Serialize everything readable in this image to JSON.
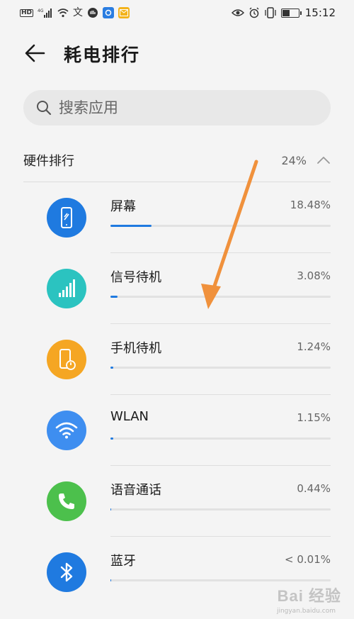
{
  "status_bar": {
    "left_icons": [
      "hd-icon",
      "4g-signal-icon",
      "wifi-icon",
      "translate-icon",
      "hand-icon",
      "app-blue-icon",
      "mail-yellow-icon"
    ],
    "right_icons": [
      "eye-icon",
      "alarm-icon",
      "vibrate-icon",
      "battery-icon"
    ],
    "hd_label": "HD",
    "net_label": "4G",
    "battery_level": 0.45,
    "time": "15:12"
  },
  "header": {
    "title": "耗电排行"
  },
  "search": {
    "placeholder": "搜索应用"
  },
  "section": {
    "title": "硬件排行",
    "percent": "24%"
  },
  "rows": [
    {
      "name": "屏幕",
      "percent": "18.48%",
      "level": 0.185,
      "icon": "phone-screen-icon",
      "color": "#1f7ae0"
    },
    {
      "name": "信号待机",
      "percent": "3.08%",
      "level": 0.031,
      "icon": "signal-bars-icon",
      "color": "#2bc3c0"
    },
    {
      "name": "手机待机",
      "percent": "1.24%",
      "level": 0.012,
      "icon": "phone-standby-icon",
      "color": "#f5a623"
    },
    {
      "name": "WLAN",
      "percent": "1.15%",
      "level": 0.012,
      "icon": "wifi-icon",
      "color": "#3e8ef0"
    },
    {
      "name": "语音通话",
      "percent": "0.44%",
      "level": 0.004,
      "icon": "phone-call-icon",
      "color": "#4cc04c"
    },
    {
      "name": "蓝牙",
      "percent": "< 0.01%",
      "level": 0.001,
      "icon": "bluetooth-icon",
      "color": "#1f7ae0"
    }
  ],
  "watermark": {
    "text": "Bai 经验",
    "sub": "jingyan.baidu.com"
  },
  "colors": {
    "accent": "#1f7ae0",
    "annotation_arrow": "#f0913c"
  }
}
